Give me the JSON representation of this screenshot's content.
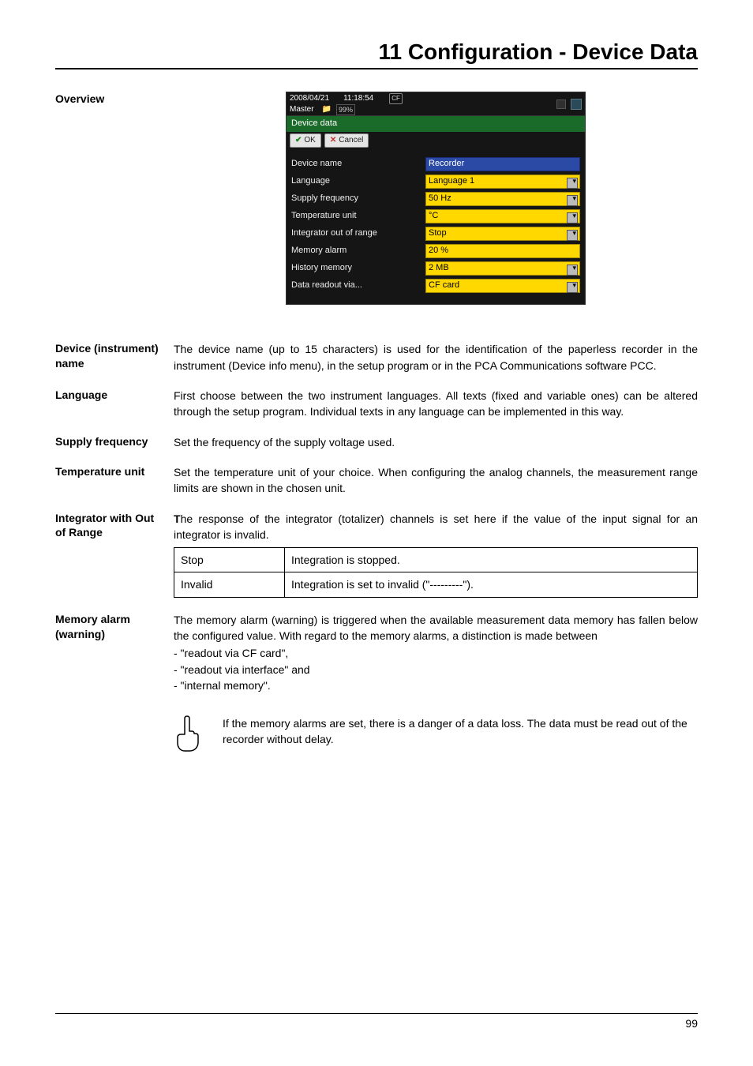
{
  "chapter_title": "11 Configuration - Device Data",
  "overview_label": "Overview",
  "device_shot": {
    "date": "2008/04/21",
    "time": "11:18:54",
    "master": "Master",
    "cf": "CF",
    "pct": "99%",
    "title": "Device data",
    "ok": "OK",
    "cancel": "Cancel",
    "rows": {
      "device_name": {
        "label": "Device name",
        "value": "Recorder"
      },
      "language": {
        "label": "Language",
        "value": "Language 1"
      },
      "supply_frequency": {
        "label": "Supply frequency",
        "value": "50 Hz"
      },
      "temperature_unit": {
        "label": "Temperature unit",
        "value": "°C"
      },
      "integrator_out": {
        "label": "Integrator out of range",
        "value": "Stop"
      },
      "memory_alarm": {
        "label": "Memory alarm",
        "value": "20 %"
      },
      "history_memory": {
        "label": "History memory",
        "value": "2 MB"
      },
      "data_readout": {
        "label": "Data readout via...",
        "value": "CF card"
      }
    }
  },
  "sections": {
    "device_name": {
      "label": "Device (instrument) name",
      "text": "The device name (up to 15 characters) is used for the identification of the paperless recorder in the instrument (Device info menu), in the setup program or in the PCA Communications software PCC."
    },
    "language": {
      "label": "Language",
      "text": "First choose between the two instrument languages. All texts (fixed and variable ones) can be altered through the setup program. Individual texts in any language can be implemented in this way."
    },
    "supply_frequency": {
      "label": "Supply frequency",
      "text": "Set the frequency of the supply voltage used."
    },
    "temperature_unit": {
      "label": "Temperature unit",
      "text": "Set the temperature unit of your choice. When configuring the analog channels, the measurement range limits are shown in the chosen unit."
    },
    "integrator": {
      "label": "Integrator with Out of Range",
      "text_prefix_bold": "T",
      "text_rest": "he response of the integrator (totalizer) channels is set here if the value of the input signal for an integrator is invalid.",
      "table": {
        "r1c1": "Stop",
        "r1c2": "Integration is stopped.",
        "r2c1": "Invalid",
        "r2c2": "Integration is set to invalid (\"---------\")."
      }
    },
    "memory_alarm": {
      "label": "Memory alarm (warning)",
      "text": "The memory alarm (warning) is triggered when the available measurement data memory has fallen below the configured value. With regard to the memory alarms,  a distinction is made between",
      "bullets": {
        "b1": "- \"readout via CF card\",",
        "b2": "- \"readout via interface\" and",
        "b3": "- \"internal memory\"."
      }
    },
    "note": "If the memory alarms are set, there is a danger of a data loss. The data must be read out of the recorder without delay."
  },
  "page_number": "99"
}
